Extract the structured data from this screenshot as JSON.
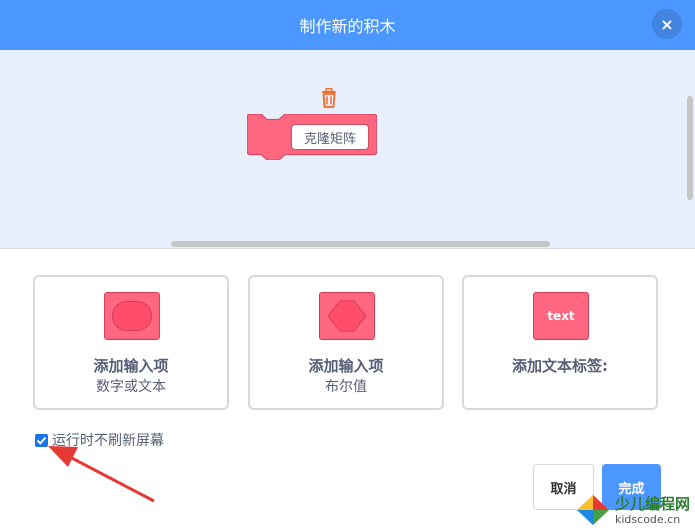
{
  "dialog": {
    "title": "制作新的积木",
    "close_symbol": "×"
  },
  "block": {
    "input_text": "克隆矩阵",
    "color": "#ff6680"
  },
  "options": [
    {
      "title": "添加输入项",
      "subtitle": "数字或文本"
    },
    {
      "title": "添加输入项",
      "subtitle": "布尔值"
    },
    {
      "title": "添加文本标签:",
      "subtitle": "",
      "icon_text": "text"
    }
  ],
  "run_without_refresh": {
    "checked": true,
    "label": "运行时不刷新屏幕"
  },
  "buttons": {
    "cancel": "取消",
    "ok": "完成"
  },
  "watermark": {
    "title": "少儿编程网",
    "url": "kidscode.cn"
  },
  "colors": {
    "header": "#4c97ff",
    "workspace": "#e8f0fe",
    "accent_arrow": "#e53935"
  }
}
